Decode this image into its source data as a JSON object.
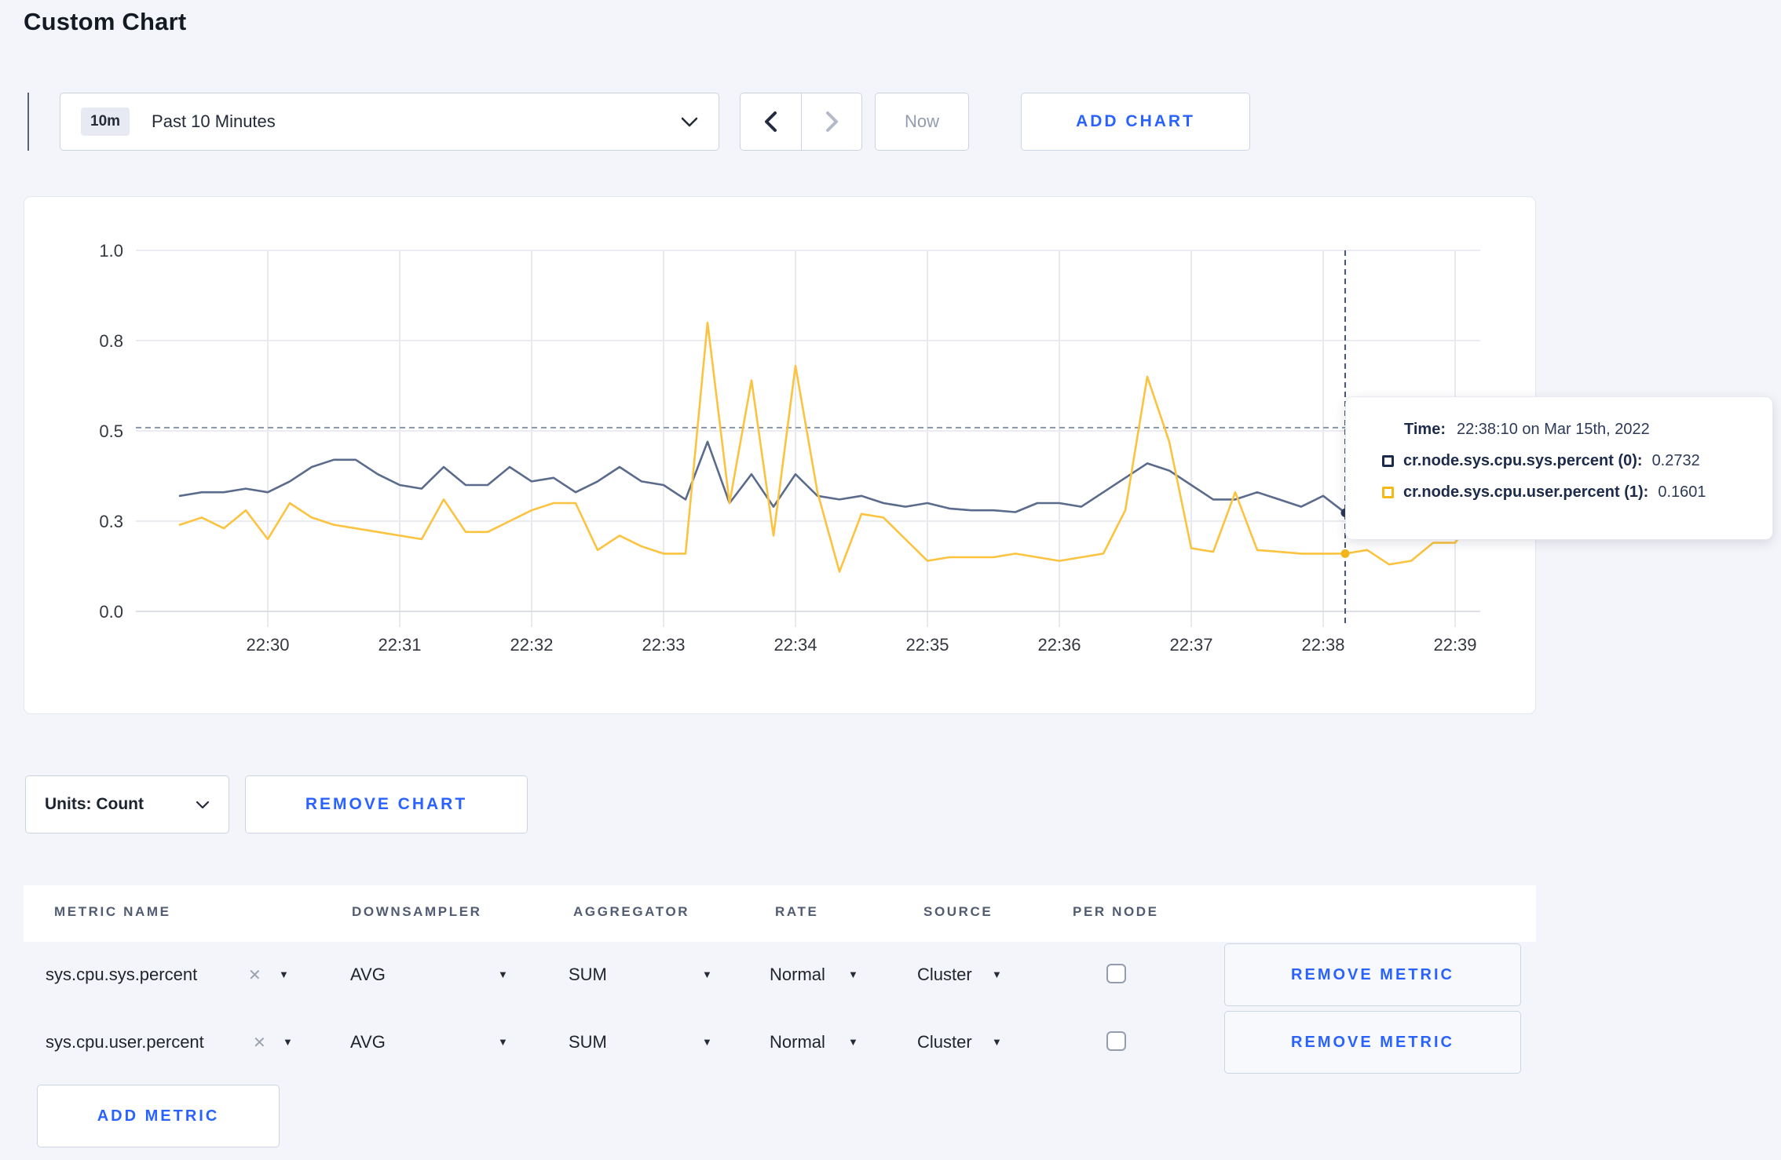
{
  "page": {
    "title": "Custom Chart"
  },
  "toolbar": {
    "time_badge": "10m",
    "time_label": "Past 10 Minutes",
    "now_label": "Now",
    "add_chart_label": "ADD CHART"
  },
  "chart_data": {
    "type": "line",
    "title": "",
    "xlabel": "",
    "ylabel": "",
    "ylim": [
      0,
      1
    ],
    "grid": true,
    "x_tick_labels": [
      "22:30",
      "22:31",
      "22:32",
      "22:33",
      "22:34",
      "22:35",
      "22:36",
      "22:37",
      "22:38",
      "22:39"
    ],
    "x_tick_minutes": [
      0,
      1,
      2,
      3,
      4,
      5,
      6,
      7,
      8,
      9
    ],
    "y_ticks": [
      {
        "v": 0,
        "label": "0.0"
      },
      {
        "v": 0.25,
        "label": "0.3"
      },
      {
        "v": 0.5,
        "label": "0.5"
      },
      {
        "v": 0.75,
        "label": "0.8"
      },
      {
        "v": 1,
        "label": "1.0"
      }
    ],
    "x_start_min": -0.6667,
    "x_step_min": 0.16667,
    "series": [
      {
        "name": "cr.node.sys.cpu.sys.percent",
        "color": "#5a6b8c",
        "values": [
          0.32,
          0.33,
          0.33,
          0.34,
          0.33,
          0.36,
          0.4,
          0.42,
          0.42,
          0.38,
          0.35,
          0.34,
          0.4,
          0.35,
          0.35,
          0.4,
          0.36,
          0.37,
          0.33,
          0.36,
          0.4,
          0.36,
          0.35,
          0.31,
          0.47,
          0.3,
          0.38,
          0.29,
          0.38,
          0.32,
          0.31,
          0.32,
          0.3,
          0.29,
          0.3,
          0.285,
          0.28,
          0.28,
          0.275,
          0.3,
          0.3,
          0.29,
          0.33,
          0.37,
          0.41,
          0.39,
          0.35,
          0.31,
          0.31,
          0.33,
          0.31,
          0.29,
          0.32,
          0.2732,
          0.3,
          0.29,
          0.31,
          0.3,
          0.3,
          0.33
        ]
      },
      {
        "name": "cr.node.sys.cpu.user.percent",
        "color": "#fbc33f",
        "values": [
          0.24,
          0.26,
          0.23,
          0.28,
          0.2,
          0.3,
          0.26,
          0.24,
          0.23,
          0.22,
          0.21,
          0.2,
          0.31,
          0.22,
          0.22,
          0.25,
          0.28,
          0.3,
          0.3,
          0.17,
          0.21,
          0.18,
          0.16,
          0.16,
          0.8,
          0.3,
          0.64,
          0.21,
          0.68,
          0.33,
          0.11,
          0.27,
          0.26,
          0.2,
          0.14,
          0.15,
          0.15,
          0.15,
          0.16,
          0.15,
          0.14,
          0.15,
          0.16,
          0.28,
          0.65,
          0.47,
          0.175,
          0.165,
          0.33,
          0.17,
          0.165,
          0.16,
          0.16,
          0.1601,
          0.17,
          0.13,
          0.14,
          0.19,
          0.19,
          0.27
        ]
      }
    ],
    "hover_guideline_value": 0.509,
    "crosshair": {
      "minute": 8.1667,
      "time": "22:38:10",
      "points": [
        {
          "value": 0.2732,
          "color": "#2b3855"
        },
        {
          "value": 0.1601,
          "color": "#f1b51e"
        }
      ]
    },
    "legend_position": "tooltip"
  },
  "tooltip": {
    "time_label": "Time:",
    "time_value": "22:38:10 on Mar 15th, 2022",
    "rows": [
      {
        "label": "cr.node.sys.cpu.sys.percent (0):",
        "value": "0.2732",
        "color": "#1d2b4a"
      },
      {
        "label": "cr.node.sys.cpu.user.percent (1):",
        "value": "0.1601",
        "color": "#f5b817"
      }
    ]
  },
  "chart_controls": {
    "units_label": "Units: Count",
    "remove_chart_label": "REMOVE CHART",
    "add_metric_label": "ADD METRIC"
  },
  "metrics_table": {
    "headers": [
      "METRIC NAME",
      "DOWNSAMPLER",
      "AGGREGATOR",
      "RATE",
      "SOURCE",
      "PER NODE"
    ],
    "rows": [
      {
        "metric": "sys.cpu.sys.percent",
        "downsampler": "AVG",
        "aggregator": "SUM",
        "rate": "Normal",
        "source": "Cluster",
        "per_node_checked": false,
        "remove_label": "REMOVE METRIC"
      },
      {
        "metric": "sys.cpu.user.percent",
        "downsampler": "AVG",
        "aggregator": "SUM",
        "rate": "Normal",
        "source": "Cluster",
        "per_node_checked": false,
        "remove_label": "REMOVE METRIC"
      }
    ]
  }
}
